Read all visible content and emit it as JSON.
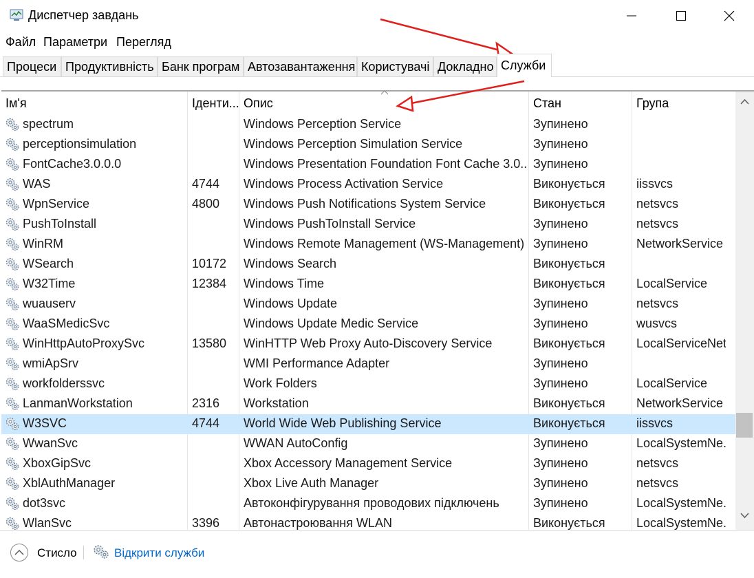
{
  "window": {
    "title": "Диспетчер завдань",
    "icon": "task-manager-icon"
  },
  "menu": [
    "Файл",
    "Параметри",
    "Перегляд"
  ],
  "tabs": [
    "Процеси",
    "Продуктивність",
    "Банк програм",
    "Автозавантаження",
    "Користувачі",
    "Докладно",
    "Служби"
  ],
  "active_tab": "Служби",
  "columns": {
    "name": "Ім'я",
    "pid": "Іденти...",
    "desc": "Опис",
    "state": "Стан",
    "group": "Група"
  },
  "rows": [
    {
      "name": "spectrum",
      "pid": "",
      "desc": "Windows Perception Service",
      "state": "Зупинено",
      "group": ""
    },
    {
      "name": "perceptionsimulation",
      "pid": "",
      "desc": "Windows Perception Simulation Service",
      "state": "Зупинено",
      "group": ""
    },
    {
      "name": "FontCache3.0.0.0",
      "pid": "",
      "desc": "Windows Presentation Foundation Font Cache 3.0...",
      "state": "Зупинено",
      "group": ""
    },
    {
      "name": "WAS",
      "pid": "4744",
      "desc": "Windows Process Activation Service",
      "state": "Виконується",
      "group": "iissvcs"
    },
    {
      "name": "WpnService",
      "pid": "4800",
      "desc": "Windows Push Notifications System Service",
      "state": "Виконується",
      "group": "netsvcs"
    },
    {
      "name": "PushToInstall",
      "pid": "",
      "desc": "Windows PushToInstall Service",
      "state": "Зупинено",
      "group": "netsvcs"
    },
    {
      "name": "WinRM",
      "pid": "",
      "desc": "Windows Remote Management (WS-Management)",
      "state": "Зупинено",
      "group": "NetworkService"
    },
    {
      "name": "WSearch",
      "pid": "10172",
      "desc": "Windows Search",
      "state": "Виконується",
      "group": ""
    },
    {
      "name": "W32Time",
      "pid": "12384",
      "desc": "Windows Time",
      "state": "Виконується",
      "group": "LocalService"
    },
    {
      "name": "wuauserv",
      "pid": "",
      "desc": "Windows Update",
      "state": "Зупинено",
      "group": "netsvcs"
    },
    {
      "name": "WaaSMedicSvc",
      "pid": "",
      "desc": "Windows Update Medic Service",
      "state": "Зупинено",
      "group": "wusvcs"
    },
    {
      "name": "WinHttpAutoProxySvc",
      "pid": "13580",
      "desc": "WinHTTP Web Proxy Auto-Discovery Service",
      "state": "Виконується",
      "group": "LocalServiceNet..."
    },
    {
      "name": "wmiApSrv",
      "pid": "",
      "desc": "WMI Performance Adapter",
      "state": "Зупинено",
      "group": ""
    },
    {
      "name": "workfolderssvc",
      "pid": "",
      "desc": "Work Folders",
      "state": "Зупинено",
      "group": "LocalService"
    },
    {
      "name": "LanmanWorkstation",
      "pid": "2316",
      "desc": "Workstation",
      "state": "Виконується",
      "group": "NetworkService"
    },
    {
      "name": "W3SVC",
      "pid": "4744",
      "desc": "World Wide Web Publishing Service",
      "state": "Виконується",
      "group": "iissvcs",
      "selected": true
    },
    {
      "name": "WwanSvc",
      "pid": "",
      "desc": "WWAN AutoConfig",
      "state": "Зупинено",
      "group": "LocalSystemNe..."
    },
    {
      "name": "XboxGipSvc",
      "pid": "",
      "desc": "Xbox Accessory Management Service",
      "state": "Зупинено",
      "group": "netsvcs"
    },
    {
      "name": "XblAuthManager",
      "pid": "",
      "desc": "Xbox Live Auth Manager",
      "state": "Зупинено",
      "group": "netsvcs"
    },
    {
      "name": "dot3svc",
      "pid": "",
      "desc": "Автоконфігурування проводових підключень",
      "state": "Зупинено",
      "group": "LocalSystemNe..."
    },
    {
      "name": "WlanSvc",
      "pid": "3396",
      "desc": "Автонастроювання WLAN",
      "state": "Виконується",
      "group": "LocalSystemNe..."
    }
  ],
  "status": {
    "less_label": "Стисло",
    "open_services_label": "Відкрити служби"
  },
  "colors": {
    "selected_row": "#cce8ff",
    "link": "#0066cc",
    "annotation_arrow": "#e0201c"
  }
}
